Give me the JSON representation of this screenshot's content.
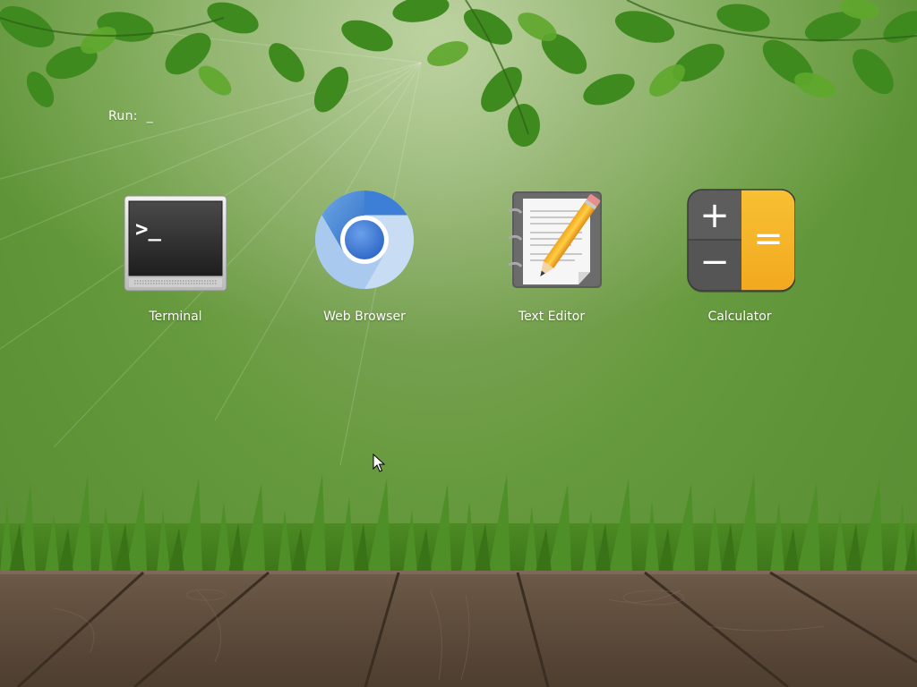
{
  "run_bar": {
    "label": "Run:",
    "input_value": "_"
  },
  "launchers": [
    {
      "label": "Terminal",
      "icon": "terminal-icon",
      "glyph": ">_"
    },
    {
      "label": "Web Browser",
      "icon": "chromium-browser-icon"
    },
    {
      "label": "Text Editor",
      "icon": "text-editor-notebook-pencil-icon"
    },
    {
      "label": "Calculator",
      "icon": "calculator-icon",
      "glyphs": [
        "+",
        "=",
        "−"
      ]
    }
  ],
  "colors": {
    "label_text": "#ffffff",
    "calculator_accent": "#f5b731",
    "browser_blue": "#3d7fd6"
  }
}
